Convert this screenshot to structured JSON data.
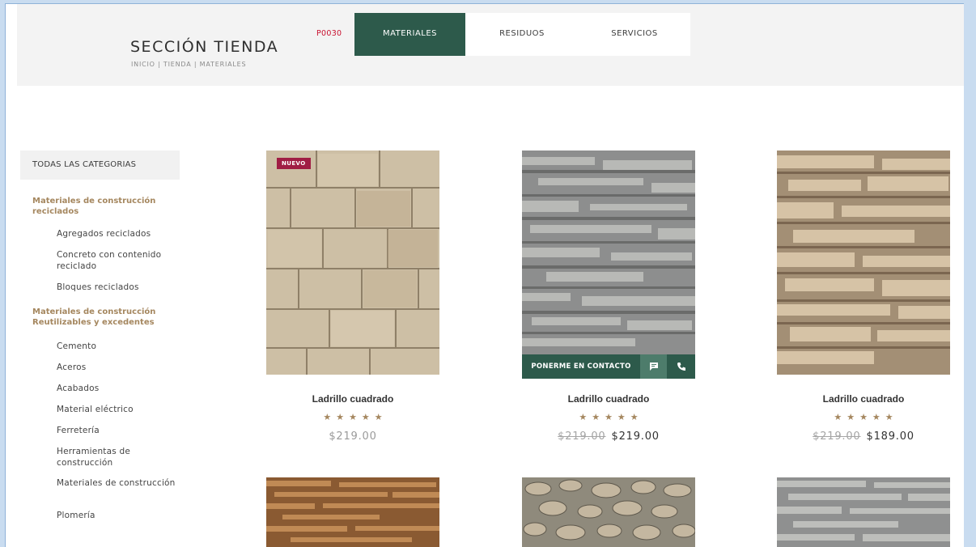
{
  "header": {
    "title": "SECCIÓN TIENDA",
    "breadcrumb": "INICIO  |  TIENDA   |  MATERIALES",
    "code": "P0030"
  },
  "nav": {
    "tabs": [
      {
        "label": "MATERIALES",
        "active": true
      },
      {
        "label": "RESIDUOS",
        "active": false
      },
      {
        "label": "SERVICIOS",
        "active": false
      }
    ]
  },
  "sidebar": {
    "header": "TODAS LAS CATEGORIAS",
    "groups": [
      {
        "title": "Materiales de construcción reciclados",
        "items": [
          "Agregados reciclados",
          "Concreto con contenido reciclado",
          "Bloques reciclados"
        ]
      },
      {
        "title": "Materiales de construcción Reutilizables y excedentes",
        "items": [
          "Cemento",
          "Aceros",
          "Acabados",
          "Material eléctrico",
          "Ferretería",
          "Herramientas de construcción",
          "Materiales de construcción",
          "Plomería"
        ]
      }
    ]
  },
  "products": [
    {
      "title": "Ladrillo cuadrado",
      "stars": "★★★★★",
      "price": "$219.00",
      "badge": "NUEVO"
    },
    {
      "title": "Ladrillo cuadrado",
      "stars": "★★★★★",
      "old_price": "$219.00",
      "price": "$219.00",
      "contact_label": "PONERME EN CONTACTO"
    },
    {
      "title": "Ladrillo cuadrado",
      "stars": "★★★★★",
      "old_price": "$219.00",
      "price": "$189.00"
    }
  ],
  "colors": {
    "accent_green": "#2d5a4b",
    "accent_gold": "#a5875f",
    "badge_red": "#a01d44",
    "code_red": "#c8102e"
  }
}
